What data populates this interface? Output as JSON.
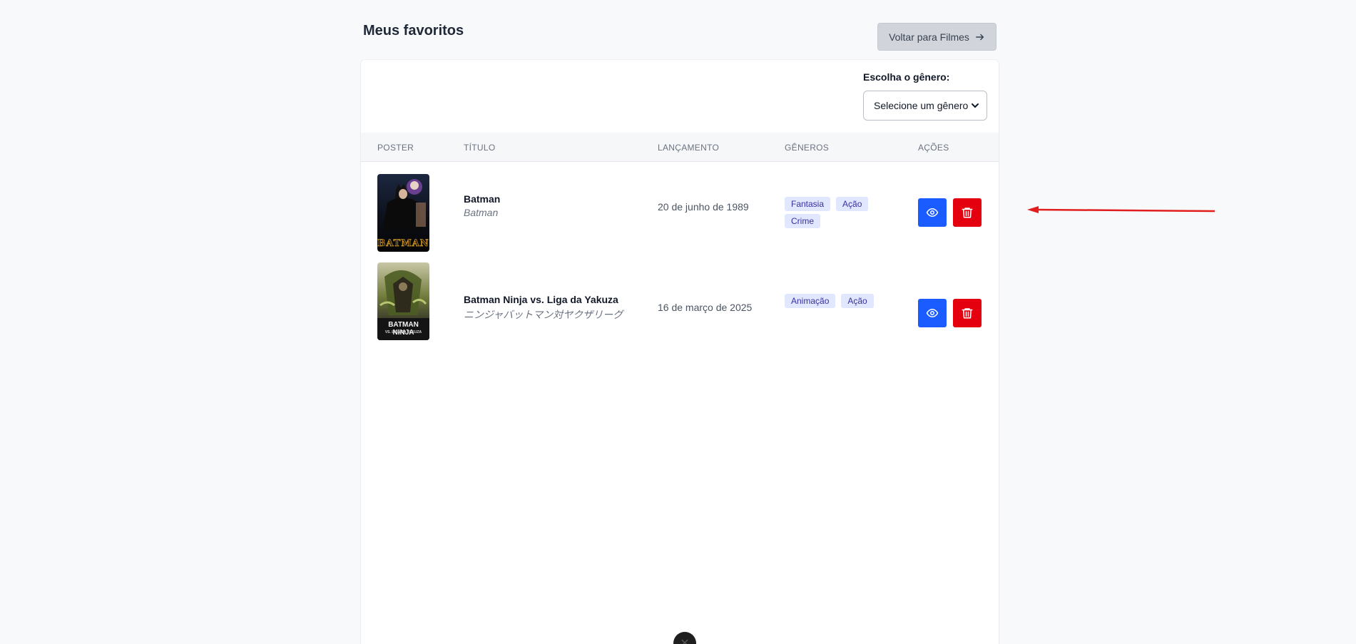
{
  "header": {
    "title": "Meus favoritos",
    "back_button_label": "Voltar para Filmes",
    "back_button_icon": "arrow-right-icon"
  },
  "filter": {
    "label": "Escolha o gênero:",
    "selected": "Selecione um gênero"
  },
  "table": {
    "columns": [
      "Poster",
      "Título",
      "Lançamento",
      "Gêneros",
      "Ações"
    ],
    "rows": [
      {
        "title": "Batman",
        "original_title": "Batman",
        "release": "20 de junho de 1989",
        "genres": [
          "Fantasia",
          "Ação",
          "Crime"
        ],
        "poster_text": "BATMAN"
      },
      {
        "title": "Batman Ninja vs. Liga da Yakuza",
        "original_title": "ニンジャバットマン対ヤクザリーグ",
        "release": "16 de março de 2025",
        "genres": [
          "Animação",
          "Ação"
        ],
        "poster_text": "BATMAN NINJA",
        "poster_subtext": "VS. LIGA DA YAKUZA"
      }
    ]
  },
  "colors": {
    "view_button": "#1a5cff",
    "delete_button": "#e4000f",
    "annotation_arrow": "#e11d1d",
    "tag_bg": "#e0e7ff",
    "tag_text": "#3730a3"
  }
}
